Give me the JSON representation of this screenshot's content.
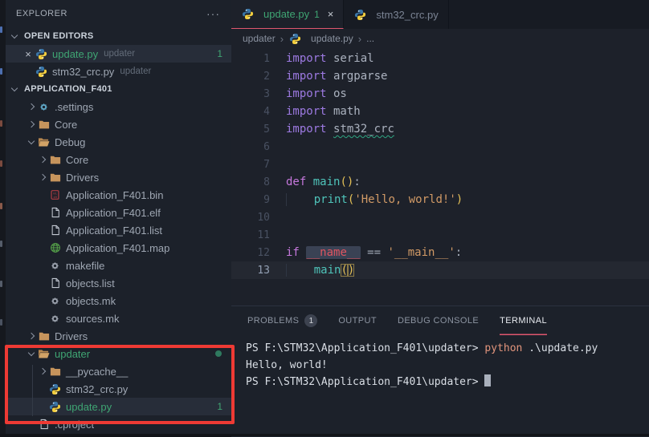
{
  "colors": {
    "background": "#1c212a",
    "tab_bar": "#171b23",
    "selected_row": "#272d39",
    "modified_green": "#3fa573",
    "accent_underline": "#e0566e",
    "annotation_red": "#ee3a34",
    "keyword_purple": "#9d7ae2",
    "function_teal": "#4fc4ba",
    "string_orange": "#d19a66",
    "bracket_gold": "#e5c157",
    "name_red": "#e05561",
    "terminal_command": "#e2957c"
  },
  "sidebar": {
    "title": "EXPLORER",
    "open_editors": {
      "label": "OPEN EDITORS",
      "items": [
        {
          "name": "update.py",
          "detail": "updater",
          "badge": "1",
          "active": true,
          "icon": "python"
        },
        {
          "name": "stm32_crc.py",
          "detail": "updater",
          "icon": "python"
        }
      ]
    },
    "workspace": {
      "label": "APPLICATION_F401",
      "items": [
        {
          "label": ".settings",
          "icon": "gear-blue",
          "level": 1,
          "chevron": "right"
        },
        {
          "label": "Core",
          "icon": "folder",
          "level": 1,
          "chevron": "right"
        },
        {
          "label": "Debug",
          "icon": "folder-open",
          "level": 1,
          "chevron": "down"
        },
        {
          "label": "Core",
          "icon": "folder",
          "level": 2,
          "chevron": "right"
        },
        {
          "label": "Drivers",
          "icon": "folder",
          "level": 2,
          "chevron": "right"
        },
        {
          "label": "Application_F401.bin",
          "icon": "binary",
          "level": 2
        },
        {
          "label": "Application_F401.elf",
          "icon": "file",
          "level": 2
        },
        {
          "label": "Application_F401.list",
          "icon": "file",
          "level": 2
        },
        {
          "label": "Application_F401.map",
          "icon": "globe",
          "level": 2
        },
        {
          "label": "makefile",
          "icon": "gear-gray",
          "level": 2
        },
        {
          "label": "objects.list",
          "icon": "file",
          "level": 2
        },
        {
          "label": "objects.mk",
          "icon": "gear-gray",
          "level": 2
        },
        {
          "label": "sources.mk",
          "icon": "gear-gray",
          "level": 2
        },
        {
          "label": "Drivers",
          "icon": "folder",
          "level": 1,
          "chevron": "right"
        },
        {
          "label": "updater",
          "icon": "folder-open",
          "level": 1,
          "chevron": "down",
          "green": true,
          "dot": true
        },
        {
          "label": "__pycache__",
          "icon": "folder",
          "level": 2,
          "chevron": "right"
        },
        {
          "label": "stm32_crc.py",
          "icon": "python",
          "level": 2
        },
        {
          "label": "update.py",
          "icon": "python",
          "level": 2,
          "green": true,
          "badge": "1",
          "selected": true
        },
        {
          "label": ".cproject",
          "icon": "file",
          "level": 1
        }
      ]
    }
  },
  "editor": {
    "tabs": [
      {
        "label": "update.py",
        "badge": "1",
        "active": true,
        "close": true,
        "icon": "python"
      },
      {
        "label": "stm32_crc.py",
        "icon": "python"
      }
    ],
    "breadcrumb": {
      "parts": [
        "updater",
        "update.py",
        "..."
      ]
    },
    "lines": [
      {
        "n": "1",
        "tokens": [
          {
            "t": "import",
            "c": "kw"
          },
          {
            "t": " serial",
            "c": "pl"
          }
        ]
      },
      {
        "n": "2",
        "tokens": [
          {
            "t": "import",
            "c": "kw"
          },
          {
            "t": " argparse",
            "c": "pl"
          }
        ]
      },
      {
        "n": "3",
        "tokens": [
          {
            "t": "import",
            "c": "kw"
          },
          {
            "t": " os",
            "c": "pl"
          }
        ]
      },
      {
        "n": "4",
        "tokens": [
          {
            "t": "import",
            "c": "kw"
          },
          {
            "t": " math",
            "c": "pl"
          }
        ]
      },
      {
        "n": "5",
        "tokens": [
          {
            "t": "import",
            "c": "kw"
          },
          {
            "t": " ",
            "c": "pl"
          },
          {
            "t": "stm32_crc",
            "c": "pl sq"
          }
        ]
      },
      {
        "n": "6",
        "tokens": []
      },
      {
        "n": "7",
        "tokens": []
      },
      {
        "n": "8",
        "tokens": [
          {
            "t": "def",
            "c": "kw2"
          },
          {
            "t": " ",
            "c": "pl"
          },
          {
            "t": "main",
            "c": "fn"
          },
          {
            "t": "(",
            "c": "br"
          },
          {
            "t": ")",
            "c": "br"
          },
          {
            "t": ":",
            "c": "pl"
          }
        ]
      },
      {
        "n": "9",
        "tokens": [
          {
            "t": "    ",
            "c": "ind"
          },
          {
            "t": "print",
            "c": "fn"
          },
          {
            "t": "(",
            "c": "br"
          },
          {
            "t": "'Hello, world!'",
            "c": "str"
          },
          {
            "t": ")",
            "c": "br"
          }
        ]
      },
      {
        "n": "10",
        "tokens": []
      },
      {
        "n": "11",
        "tokens": []
      },
      {
        "n": "12",
        "tokens": [
          {
            "t": "if",
            "c": "kw2"
          },
          {
            "t": " ",
            "c": "pl"
          },
          {
            "t": "__name__",
            "c": "special"
          },
          {
            "t": " ",
            "c": "pl"
          },
          {
            "t": "==",
            "c": "op"
          },
          {
            "t": " ",
            "c": "pl"
          },
          {
            "t": "'__main__'",
            "c": "str"
          },
          {
            "t": ":",
            "c": "pl"
          }
        ]
      },
      {
        "n": "13",
        "cur": true,
        "tokens": [
          {
            "t": "    ",
            "c": "ind"
          },
          {
            "t": "main",
            "c": "fn"
          },
          {
            "t": "(",
            "c": "br bx"
          },
          {
            "t": ")",
            "c": "br bx"
          }
        ]
      }
    ]
  },
  "panel": {
    "tabs": [
      {
        "label": "PROBLEMS",
        "badge": "1"
      },
      {
        "label": "OUTPUT"
      },
      {
        "label": "DEBUG CONSOLE"
      },
      {
        "label": "TERMINAL",
        "active": true
      }
    ],
    "terminal": [
      {
        "parts": [
          {
            "t": "PS F:\\STM32\\Application_F401\\updater> ",
            "c": "t"
          },
          {
            "t": "python",
            "c": "cmd"
          },
          {
            "t": " .\\update.py",
            "c": "t"
          }
        ]
      },
      {
        "parts": [
          {
            "t": "Hello, world!",
            "c": "t"
          }
        ]
      },
      {
        "parts": [
          {
            "t": "PS F:\\STM32\\Application_F401\\updater> ",
            "c": "t"
          }
        ],
        "cursor": true
      }
    ]
  }
}
